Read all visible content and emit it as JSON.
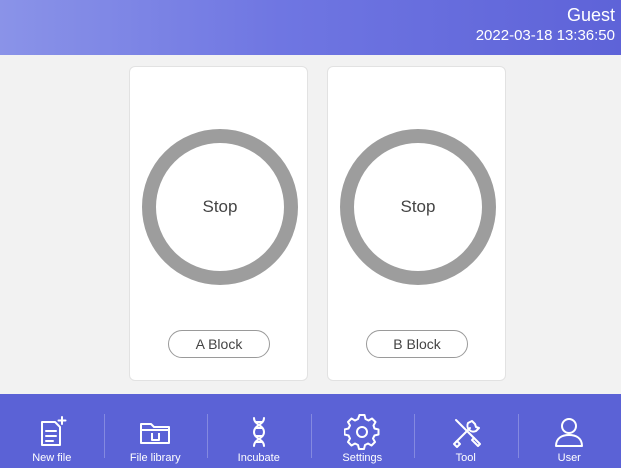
{
  "header": {
    "user": "Guest",
    "datetime": "2022-03-18 13:36:50"
  },
  "blocks": [
    {
      "status": "Stop",
      "label": "A Block"
    },
    {
      "status": "Stop",
      "label": "B Block"
    }
  ],
  "nav": [
    {
      "label": "New file",
      "icon": "new-file-icon"
    },
    {
      "label": "File library",
      "icon": "folder-icon"
    },
    {
      "label": "Incubate",
      "icon": "dna-icon"
    },
    {
      "label": "Settings",
      "icon": "gear-icon"
    },
    {
      "label": "Tool",
      "icon": "tools-icon"
    },
    {
      "label": "User",
      "icon": "user-icon"
    }
  ],
  "colors": {
    "header": "#6f76e2",
    "footer": "#5b62d6",
    "ring": "#9d9d9d"
  }
}
